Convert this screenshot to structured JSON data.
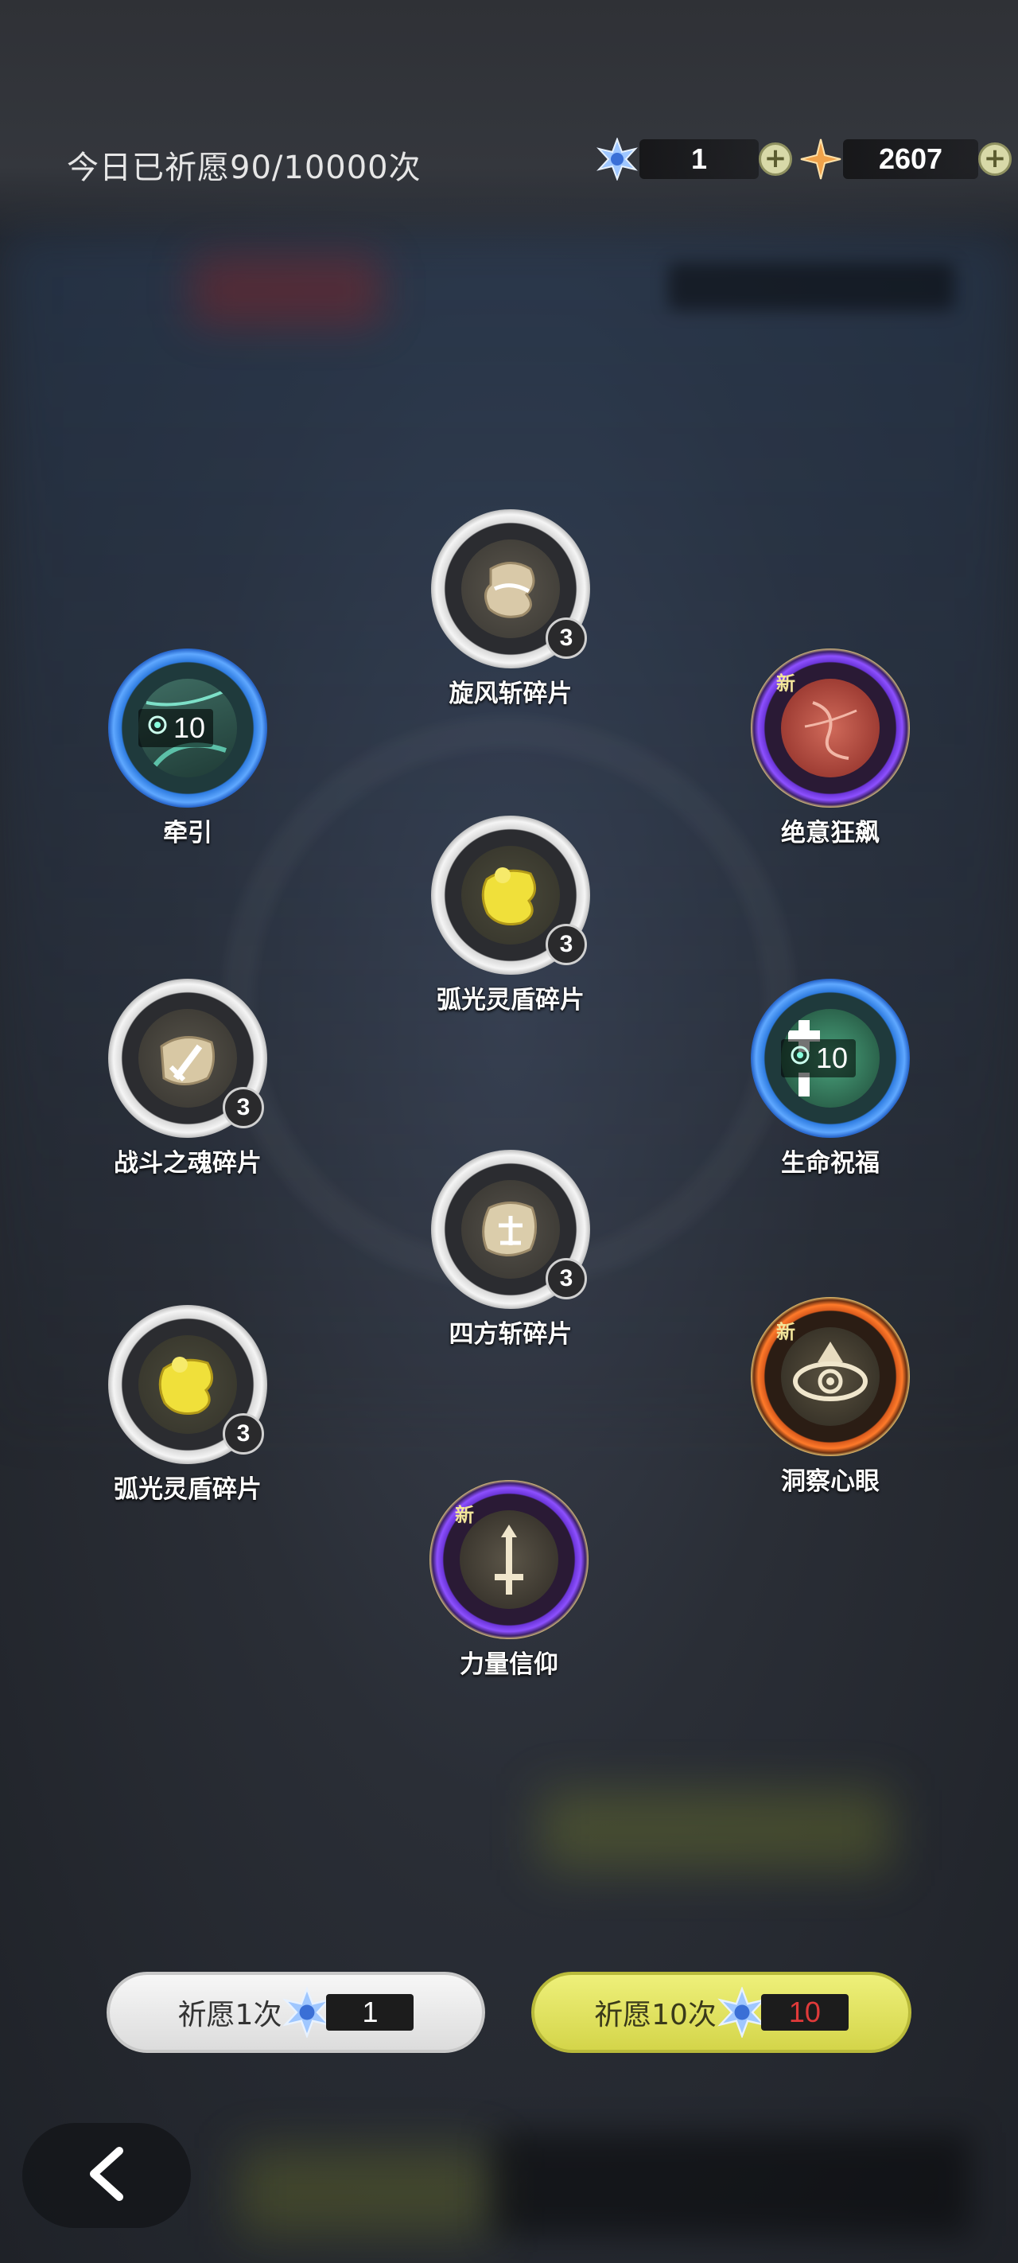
{
  "header": {
    "wish_count_text": "今日已祈愿90/10000次"
  },
  "currency": [
    {
      "name": "crystal",
      "icon": "blue-crystal-icon",
      "value": "1"
    },
    {
      "name": "star-shard",
      "icon": "orange-star-icon",
      "value": "2607"
    }
  ],
  "plus_label": "+",
  "items": [
    {
      "id": "xuanfeng",
      "label": "旋风斩碎片",
      "rarity": "white",
      "count": "3",
      "icon": "beige-fragment-icon"
    },
    {
      "id": "qianyin",
      "label": "牵引",
      "rarity": "blue",
      "qty": "10",
      "icon": "green-vine-icon"
    },
    {
      "id": "jueyi",
      "label": "绝意狂飙",
      "rarity": "purple",
      "new": "新",
      "icon": "red-orb-icon"
    },
    {
      "id": "huguang1",
      "label": "弧光灵盾碎片",
      "rarity": "white",
      "count": "3",
      "icon": "yellow-fragment-icon"
    },
    {
      "id": "zhandou",
      "label": "战斗之魂碎片",
      "rarity": "white",
      "count": "3",
      "icon": "sword-fragment-icon"
    },
    {
      "id": "shengming",
      "label": "生命祝福",
      "rarity": "blue",
      "qty": "10",
      "icon": "green-cross-icon"
    },
    {
      "id": "sifang",
      "label": "四方斩碎片",
      "rarity": "white",
      "count": "3",
      "icon": "beige-fragment-icon"
    },
    {
      "id": "huguang2",
      "label": "弧光灵盾碎片",
      "rarity": "white",
      "count": "3",
      "icon": "yellow-fragment-icon"
    },
    {
      "id": "dongcha",
      "label": "洞察心眼",
      "rarity": "orange",
      "new": "新",
      "icon": "eye-icon"
    },
    {
      "id": "liliang",
      "label": "力量信仰",
      "rarity": "purple",
      "new": "新",
      "icon": "sword-up-icon"
    }
  ],
  "buttons": {
    "wish_once": {
      "label": "祈愿1次",
      "cost": "1"
    },
    "wish_ten": {
      "label": "祈愿10次",
      "cost": "10"
    }
  },
  "back_icon": "chevron-left-icon",
  "colors": {
    "ten_cost": "#e03a3a",
    "button_yellow": "#e2e35f"
  }
}
